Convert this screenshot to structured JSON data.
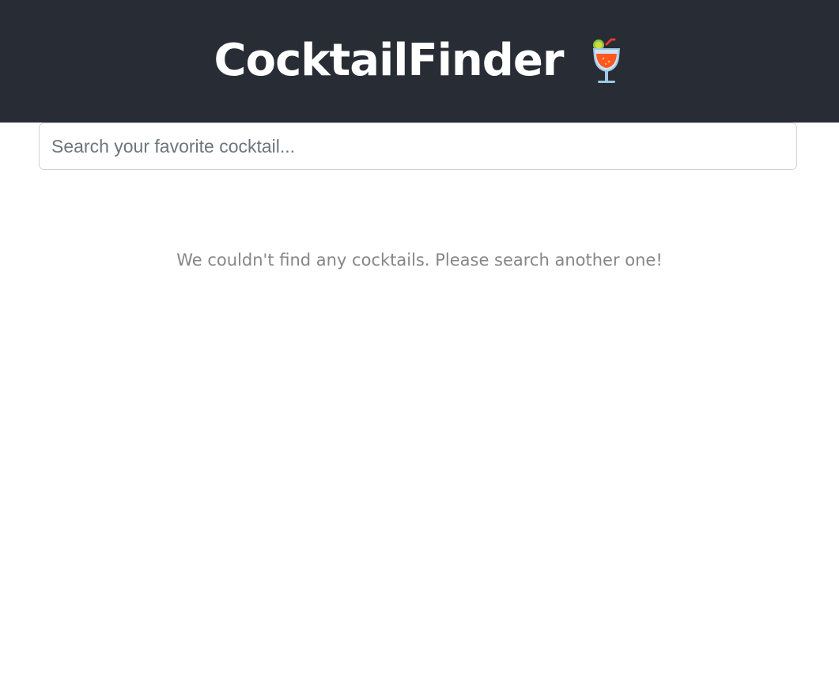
{
  "header": {
    "title": "CocktailFinder",
    "icon": "tropical-drink-icon",
    "background_color": "#282c34"
  },
  "search": {
    "value": "",
    "placeholder": "Search your favorite cocktail..."
  },
  "results": {
    "empty_message": "We couldn't find any cocktails. Please search another one!"
  }
}
